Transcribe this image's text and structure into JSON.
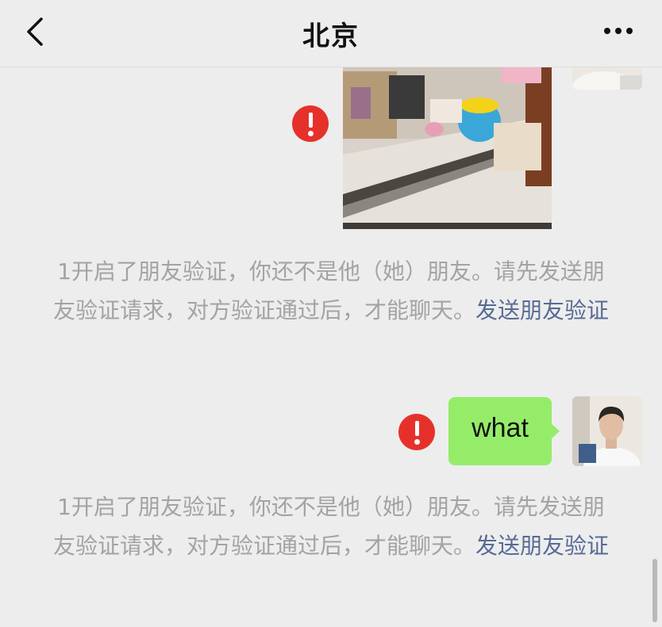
{
  "header": {
    "title": "北京",
    "back_icon": "chevron-left-icon",
    "more_icon": "more-dots-icon"
  },
  "messages": [
    {
      "type": "image",
      "status": "failed",
      "status_icon": "error-icon"
    },
    {
      "type": "system",
      "text": "1开启了朋友验证，你还不是他（她）朋友。请先发送朋友验证请求，对方验证通过后，才能聊天。",
      "link": "发送朋友验证"
    },
    {
      "type": "text",
      "text": "what",
      "status": "failed",
      "status_icon": "error-icon"
    },
    {
      "type": "system",
      "text": "1开启了朋友验证，你还不是他（她）朋友。请先发送朋友验证请求，对方验证通过后，才能聊天。",
      "link": "发送朋友验证"
    }
  ],
  "colors": {
    "background": "#ededed",
    "bubble": "#95ec69",
    "error": "#e6312b",
    "link": "#576b95",
    "system_text": "#a3a3a3"
  }
}
